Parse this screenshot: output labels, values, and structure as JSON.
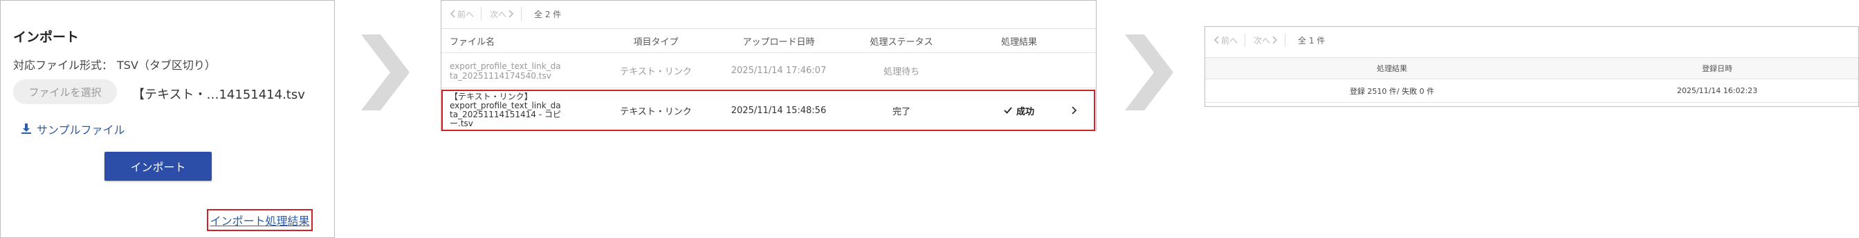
{
  "import_dialog": {
    "title": "インポート",
    "format_label": "対応ファイル形式：",
    "format_value": "TSV（タブ区切り）",
    "choose_file_label": "ファイルを選択",
    "selected_file": "【テキスト・…14151414.tsv",
    "sample_file_label": "サンプルファイル",
    "import_button_label": "インポート",
    "result_link_label": "インポート処理結果"
  },
  "import_list": {
    "pager": {
      "prev_label": "前へ",
      "next_label": "次へ",
      "total": "全 2 件"
    },
    "columns": [
      "ファイル名",
      "項目タイプ",
      "アップロード日時",
      "処理ステータス",
      "処理結果"
    ],
    "rows": [
      {
        "file_name": "export_profile_text_link_da\nta_20251114174540.tsv",
        "item_type": "テキスト・リンク",
        "uploaded_at": "2025/11/14 17:46:07",
        "status": "処理待ち",
        "result": ""
      },
      {
        "file_name": "【テキスト・リンク】\nexport_profile_text_link_da\nta_20251114151414 - コピ\nー.tsv",
        "item_type": "テキスト・リンク",
        "uploaded_at": "2025/11/14 15:48:56",
        "status": "完了",
        "result": "成功"
      }
    ]
  },
  "result_detail": {
    "pager": {
      "prev_label": "前へ",
      "next_label": "次へ",
      "total": "全 1 件"
    },
    "columns": [
      "処理結果",
      "登録日時"
    ],
    "row": {
      "result": "登録 2510 件/ 失敗 0 件",
      "registered_at": "2025/11/14 16:02:23"
    }
  },
  "colors": {
    "accent": "#2c4ea8",
    "link": "#2a5caa",
    "highlight": "#d0202a",
    "chevron": "#d9d9d9"
  }
}
